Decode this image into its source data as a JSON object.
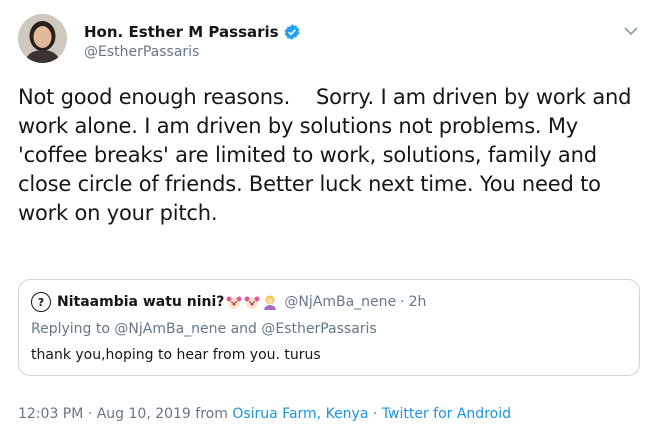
{
  "author": {
    "name": "Hon. Esther M Passaris",
    "handle": "@EstherPassaris",
    "verified_color": "#1da1f2"
  },
  "tweet": {
    "text": "Not good enough reasons.    Sorry. I am driven by work and work alone. I am driven by solutions not problems. My 'coffee breaks' are limited to work, solutions, family and close circle of friends. Better luck next time. You need to work on your pitch."
  },
  "quoted": {
    "avatar_glyph": "?",
    "name": "Nitaambia watu nini?",
    "handle": "@NjAmBa_nene",
    "time": "2h",
    "reply_prefix": "Replying to",
    "reply_user1": "@NjAmBa_nene",
    "reply_and": "and",
    "reply_user2": "@EstherPassaris",
    "text": "thank you,hoping to hear from you. turus"
  },
  "meta": {
    "time": "12:03 PM",
    "date": "Aug 10, 2019",
    "from": "from",
    "location": "Osirua Farm, Kenya",
    "source": "Twitter for Android",
    "sep": "·"
  },
  "colors": {
    "link": "#1b95e0",
    "secondary": "#657786",
    "border": "#ccd6dd"
  },
  "icons": [
    "verified-badge-icon",
    "chevron-down-icon",
    "clown-face-icon",
    "person-emoji-icon"
  ]
}
